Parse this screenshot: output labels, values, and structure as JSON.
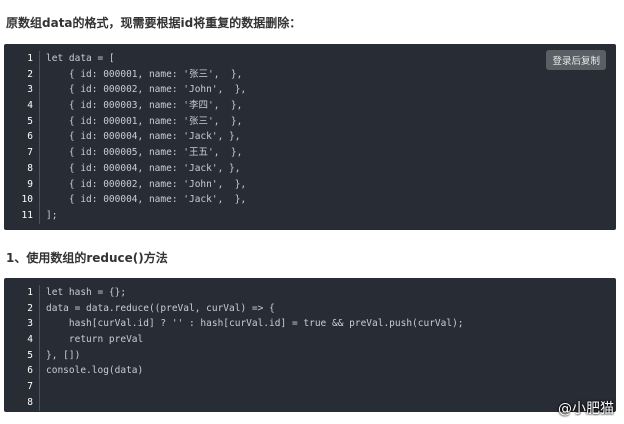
{
  "heading1": "原数组data的格式，现需要根据id将重复的数据删除：",
  "copy_button_label": "登录后复制",
  "block1_lines": [
    {
      "n": "1",
      "code": "let data = ["
    },
    {
      "n": "2",
      "code": "    { id: 000001, name: '张三',  },"
    },
    {
      "n": "3",
      "code": "    { id: 000002, name: 'John',  },"
    },
    {
      "n": "4",
      "code": "    { id: 000003, name: '李四',  },"
    },
    {
      "n": "5",
      "code": "    { id: 000001, name: '张三',  },"
    },
    {
      "n": "6",
      "code": "    { id: 000004, name: 'Jack', },"
    },
    {
      "n": "7",
      "code": "    { id: 000005, name: '王五',  },"
    },
    {
      "n": "8",
      "code": "    { id: 000004, name: 'Jack', },"
    },
    {
      "n": "9",
      "code": "    { id: 000002, name: 'John',  },"
    },
    {
      "n": "10",
      "code": "    { id: 000004, name: 'Jack',  },"
    },
    {
      "n": "11",
      "code": "];"
    }
  ],
  "heading2": "1、使用数组的reduce()方法",
  "block2_lines": [
    {
      "n": "1",
      "code": "let hash = {};"
    },
    {
      "n": "2",
      "code": "data = data.reduce((preVal, curVal) => {"
    },
    {
      "n": "3",
      "code": "    hash[curVal.id] ? '' : hash[curVal.id] = true && preVal.push(curVal);"
    },
    {
      "n": "4",
      "code": "    return preVal"
    },
    {
      "n": "5",
      "code": "}, [])"
    },
    {
      "n": "6",
      "code": "console.log(data)"
    },
    {
      "n": "7",
      "code": ""
    },
    {
      "n": "8",
      "code": ""
    }
  ],
  "watermark": "@小肥猫"
}
